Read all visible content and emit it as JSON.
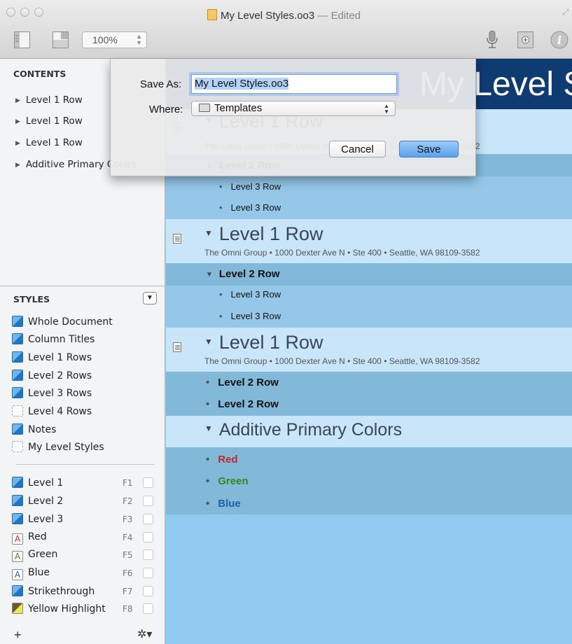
{
  "window": {
    "title": "My Level Styles.oo3",
    "edited": "— Edited",
    "zoom": "100%"
  },
  "sidebar": {
    "contents_header": "CONTENTS",
    "contents": [
      "Level 1 Row",
      "Level 1 Row",
      "Level 1 Row",
      "Additive Primary Colors"
    ],
    "styles_header": "STYLES",
    "styles": [
      {
        "label": "Whole Document",
        "swatch": "blue"
      },
      {
        "label": "Column Titles",
        "swatch": "blue"
      },
      {
        "label": "Level 1 Rows",
        "swatch": "blue"
      },
      {
        "label": "Level 2 Rows",
        "swatch": "blue"
      },
      {
        "label": "Level 3 Rows",
        "swatch": "blue"
      },
      {
        "label": "Level 4 Rows",
        "swatch": "dashed"
      },
      {
        "label": "Notes",
        "swatch": "blue"
      },
      {
        "label": "My Level Styles",
        "swatch": "dashed"
      }
    ],
    "named_styles": [
      {
        "label": "Level 1",
        "key": "F1",
        "swatch": "blue"
      },
      {
        "label": "Level 2",
        "key": "F2",
        "swatch": "blue"
      },
      {
        "label": "Level 3",
        "key": "F3",
        "swatch": "blue"
      },
      {
        "label": "Red",
        "key": "F4",
        "swatch": "A",
        "color": "#cc2222"
      },
      {
        "label": "Green",
        "key": "F5",
        "swatch": "A",
        "color": "#3a8a1a"
      },
      {
        "label": "Blue",
        "key": "F6",
        "swatch": "A",
        "color": "#1f5fb0"
      },
      {
        "label": "Strikethrough",
        "key": "F7",
        "swatch": "blue"
      },
      {
        "label": "Yellow Highlight",
        "key": "F8",
        "swatch": "highlight"
      }
    ],
    "add": "+",
    "gear": "✲▾"
  },
  "outline": {
    "banner_title": "My Level Styles",
    "address": "The Omni Group • 1000 Dexter Ave N • Ste 400 • Seattle, WA 98109-3582",
    "level1": "Level 1 Row",
    "level2": "Level 2 Row",
    "level3": "Level 3 Row",
    "additive": "Additive Primary Colors",
    "colors": [
      {
        "label": "Red",
        "color": "#c0262c"
      },
      {
        "label": "Green",
        "color": "#2f8a1f"
      },
      {
        "label": "Blue",
        "color": "#1f5fa8"
      }
    ]
  },
  "save_sheet": {
    "save_as_label": "Save As:",
    "save_as_value": "My Level Styles.oo3",
    "where_label": "Where:",
    "where_value": "Templates",
    "cancel": "Cancel",
    "save": "Save"
  }
}
